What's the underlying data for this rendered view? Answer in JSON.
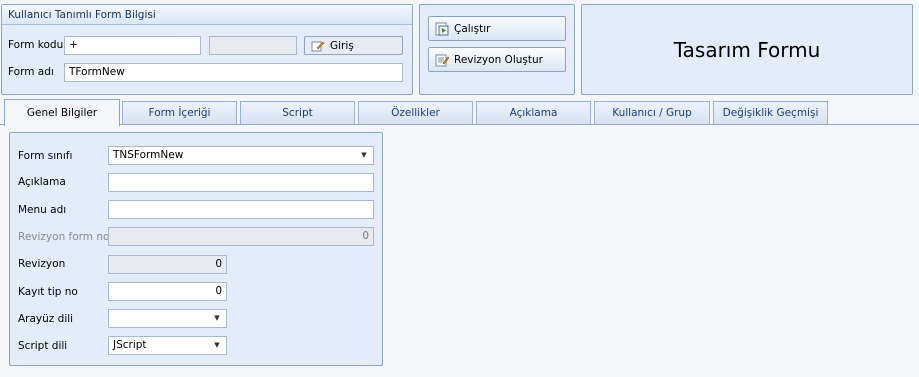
{
  "header_group": {
    "title": "Kullanıcı Tanımlı Form Bilgisi",
    "form_kodu_label": "Form kodu",
    "form_kodu_value": "+",
    "giris_label": "Giriş",
    "form_adi_label": "Form adı",
    "form_adi_value": "TFormNew"
  },
  "actions": {
    "calistir_label": "Çalıştır",
    "revizyon_olustur_label": "Revizyon Oluştur"
  },
  "title_panel": {
    "text": "Tasarım Formu"
  },
  "tabs": [
    {
      "label": "Genel Bilgiler",
      "active": true
    },
    {
      "label": "Form İçeriği"
    },
    {
      "label": "Script"
    },
    {
      "label": "Özellikler"
    },
    {
      "label": "Açıklama"
    },
    {
      "label": "Kullanıcı / Grup"
    },
    {
      "label": "Değişiklik Geçmişi"
    }
  ],
  "general": {
    "form_sinifi_label": "Form sınıfı",
    "form_sinifi_value": "TNSFormNew",
    "aciklama_label": "Açıklama",
    "aciklama_value": "",
    "menu_adi_label": "Menu adı",
    "menu_adi_value": "",
    "revizyon_form_no_label": "Revizyon form no",
    "revizyon_form_no_value": "0",
    "revizyon_label": "Revizyon",
    "revizyon_value": "0",
    "kayit_tip_no_label": "Kayıt tip no",
    "kayit_tip_no_value": "0",
    "arayuz_dili_label": "Arayüz dili",
    "arayuz_dili_value": "",
    "script_dili_label": "Script dili",
    "script_dili_value": "JScript"
  }
}
